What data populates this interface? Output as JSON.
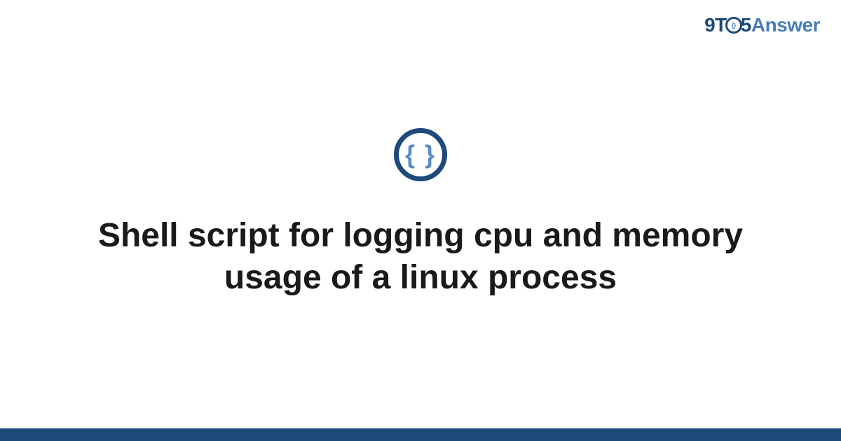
{
  "brand": {
    "part_9t": "9T",
    "part_5": "5",
    "part_answer": "Answer"
  },
  "category": {
    "icon_glyph": "{ }",
    "name": "code"
  },
  "title": "Shell script for logging cpu and memory usage of a linux process",
  "colors": {
    "primary": "#1e4a7a",
    "accent": "#4a7db8"
  }
}
